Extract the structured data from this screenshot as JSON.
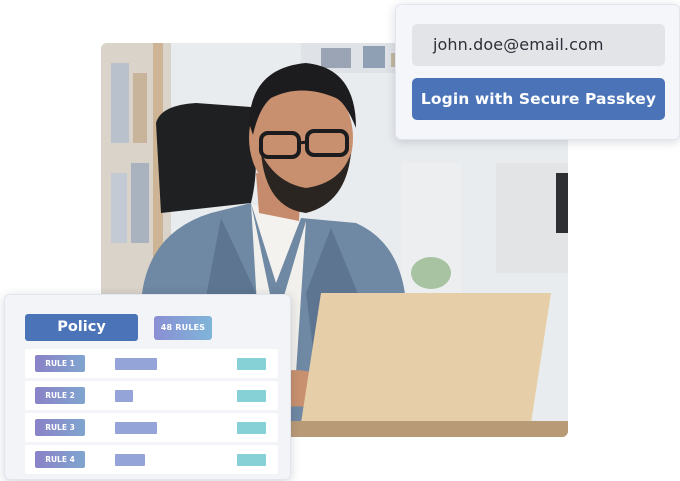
{
  "login": {
    "email_value": "john.doe@email.com",
    "passkey_button": "Login with Secure Passkey"
  },
  "policy": {
    "title": "Policy",
    "rules_badge": "48 RULES",
    "rules": [
      {
        "label": "RULE 1",
        "bar_fill": 0.7
      },
      {
        "label": "RULE 2",
        "bar_fill": 0.3
      },
      {
        "label": "RULE 3",
        "bar_fill": 0.7
      },
      {
        "label": "RULE 4",
        "bar_fill": 0.5
      }
    ]
  },
  "colors": {
    "accent": "#4a73b8",
    "card_bg": "#f5f6f9",
    "status_teal": "#86d1d6",
    "bar_periwinkle": "#95a4d8"
  },
  "photo": {
    "subject": "man-with-laptop-photo"
  }
}
